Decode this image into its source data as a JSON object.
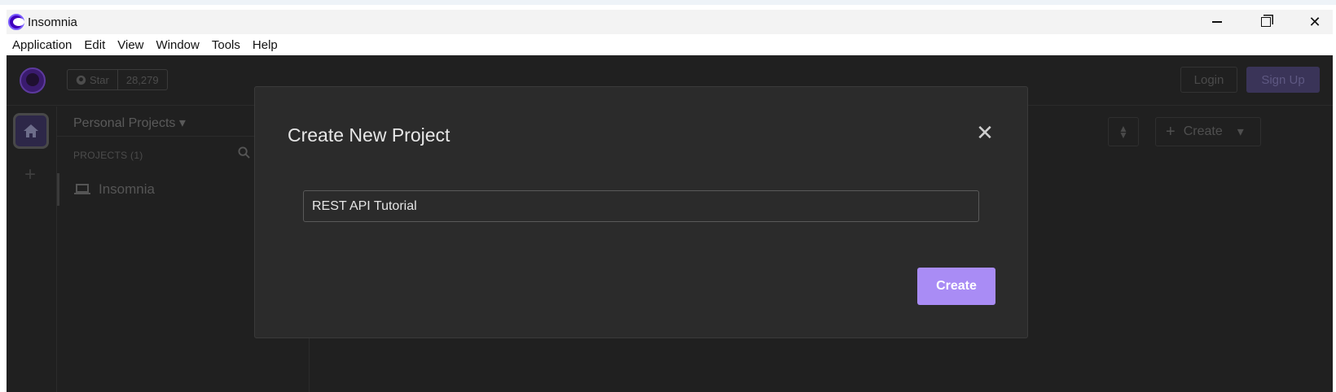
{
  "window": {
    "title": "Insomnia"
  },
  "menubar": {
    "items": [
      "Application",
      "Edit",
      "View",
      "Window",
      "Tools",
      "Help"
    ]
  },
  "topbar": {
    "github_star_label": "Star",
    "github_star_count": "28,279",
    "login_label": "Login",
    "signup_label": "Sign Up"
  },
  "sidebar": {
    "project_dropdown": "Personal Projects",
    "projects_header": "PROJECTS (1)",
    "projects": [
      {
        "name": "Insomnia"
      }
    ]
  },
  "main": {
    "create_label": "Create"
  },
  "modal": {
    "title": "Create New Project",
    "input_value": "REST API Tutorial",
    "create_label": "Create"
  },
  "colors": {
    "app_bg": "#202020",
    "modal_bg": "#2b2b2b",
    "accent": "#a98cf5"
  },
  "icons": [
    "insomnia-logo-icon",
    "github-icon",
    "home-icon",
    "plus-icon",
    "search-icon",
    "laptop-icon",
    "sort-icon",
    "caret-down-icon",
    "close-icon"
  ]
}
